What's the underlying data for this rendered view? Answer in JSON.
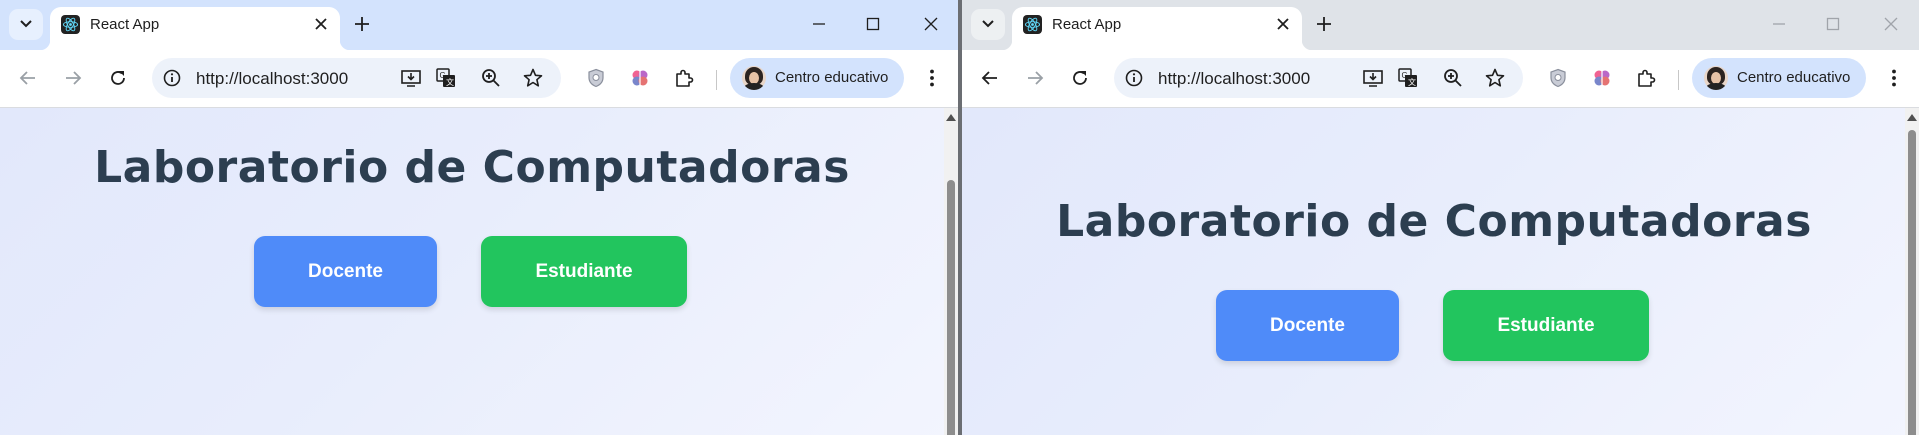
{
  "windows": [
    {
      "tab_title": "React App",
      "url": "http://localhost:3000",
      "profile_label": "Centro educativo",
      "page": {
        "heading": "Laboratorio de Computadoras",
        "docente_label": "Docente",
        "estudiante_label": "Estudiante"
      }
    },
    {
      "tab_title": "React App",
      "url": "http://localhost:3000",
      "profile_label": "Centro educativo",
      "page": {
        "heading": "Laboratorio de Computadoras",
        "docente_label": "Docente",
        "estudiante_label": "Estudiante"
      }
    }
  ],
  "colors": {
    "docente_button": "#4f8bf9",
    "estudiante_button": "#22c55e",
    "heading_text": "#2c3e50",
    "tabstrip_active": "#d3e3fd",
    "tabstrip_inactive": "#dfe3e8"
  },
  "icons": [
    "tab-search-icon",
    "react-favicon-icon",
    "close-icon",
    "plus-icon",
    "minimize-icon",
    "maximize-icon",
    "back-icon",
    "forward-icon",
    "reload-icon",
    "site-info-icon",
    "install-app-icon",
    "translate-icon",
    "zoom-icon",
    "bookmark-star-icon",
    "extension-shield-icon",
    "extension-brain-icon",
    "extensions-puzzle-icon",
    "kebab-menu-icon"
  ]
}
